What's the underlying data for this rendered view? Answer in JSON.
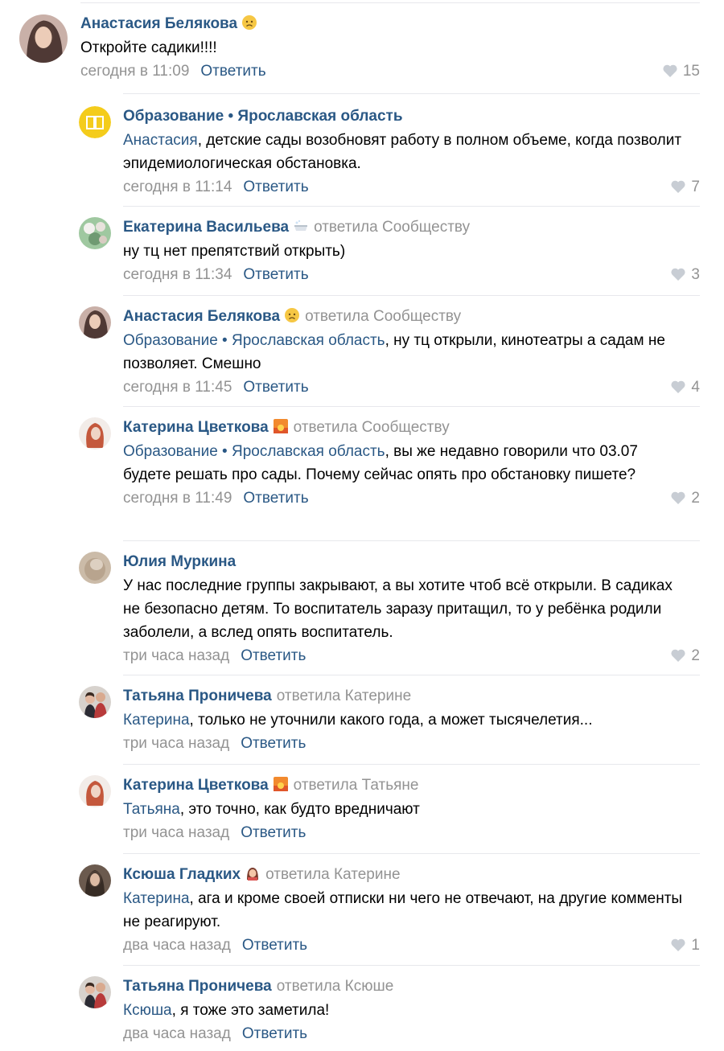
{
  "reply_label": "Ответить",
  "comments": [
    {
      "author": "Анастасия Белякова",
      "emoji": "worried-face-emoji",
      "replied": "",
      "mention": "",
      "separator": "",
      "text": "Откройте садики!!!!",
      "date": "сегодня в 11:09",
      "likes": "15",
      "avatar": "woman-photo-avatar"
    },
    {
      "author": "Образование • Ярославская область",
      "emoji": "",
      "replied": "",
      "mention": "Анастасия",
      "separator": ", ",
      "text": "детские сады возобновят работу в полном объеме, когда позволит эпидемиологическая обстановка.",
      "date": "сегодня в 11:14",
      "likes": "7",
      "avatar": "book-logo-avatar"
    },
    {
      "author": "Екатерина Васильева",
      "emoji": "bathtub-emoji",
      "replied": "ответила Сообществу",
      "mention": "",
      "separator": "",
      "text": "ну тц нет препятствий открыть)",
      "date": "сегодня в 11:34",
      "likes": "3",
      "avatar": "flowers-photo-avatar"
    },
    {
      "author": "Анастасия Белякова",
      "emoji": "worried-face-emoji",
      "replied": "ответила Сообществу",
      "mention": "Образование • Ярославская область",
      "separator": ", ",
      "text": "ну тц открыли, кинотеатры а садам не позволяет. Смешно",
      "date": "сегодня в 11:45",
      "likes": "4",
      "avatar": "woman-photo-avatar"
    },
    {
      "author": "Катерина Цветкова",
      "emoji": "sunset-emoji",
      "replied": "ответила Сообществу",
      "mention": "Образование • Ярославская область",
      "separator": ", ",
      "text": "вы же недавно говорили что 03.07 будете решать про сады. Почему сейчас опять про обстановку пишете?",
      "date": "сегодня в 11:49",
      "likes": "2",
      "avatar": "redhead-photo-avatar"
    },
    {
      "author": "Юлия Муркина",
      "emoji": "",
      "replied": "",
      "mention": "",
      "separator": "",
      "text": "У нас последние группы закрывают, а вы хотите чтоб всё открыли. В садиках не безопасно детям. То воспитатель заразу притащил, то у ребёнка родили заболели, а вслед опять воспитатель.",
      "date": "три часа назад",
      "likes": "2",
      "avatar": "beige-photo-avatar"
    },
    {
      "author": "Татьяна Проничева",
      "emoji": "",
      "replied": "ответила Катерине",
      "mention": "Катерина",
      "separator": ", ",
      "text": "только не уточнили какого года, а может тысячелетия...",
      "date": "три часа назад",
      "likes": "",
      "avatar": "couple-photo-avatar"
    },
    {
      "author": "Катерина Цветкова",
      "emoji": "sunset-emoji",
      "replied": "ответила Татьяне",
      "mention": "Татьяна",
      "separator": ", ",
      "text": "это точно, как будто вредничают",
      "date": "три часа назад",
      "likes": "",
      "avatar": "redhead-photo-avatar"
    },
    {
      "author": "Ксюша Гладких",
      "emoji": "woman-emoji",
      "replied": "ответила Катерине",
      "mention": "Катерина",
      "separator": ", ",
      "text": "ага и кроме своей отписки ни чего не отвечают, на другие комменты не реагируют.",
      "date": "два часа назад",
      "likes": "1",
      "avatar": "dark-photo-avatar"
    },
    {
      "author": "Татьяна Проничева",
      "emoji": "",
      "replied": "ответила Ксюше",
      "mention": "Ксюша",
      "separator": ", ",
      "text": "я тоже это заметила!",
      "date": "два часа назад",
      "likes": "",
      "avatar": "couple-photo-avatar"
    }
  ]
}
